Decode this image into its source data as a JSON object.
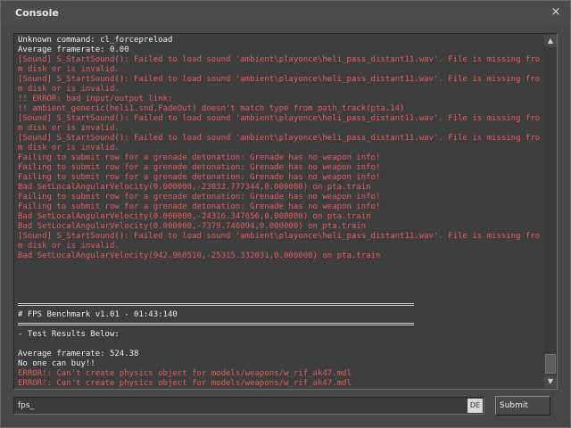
{
  "window": {
    "title": "Console",
    "close_glyph": "×"
  },
  "console": {
    "lines": [
      {
        "type": "normal",
        "text": "Unknown command: cl_forcepreload"
      },
      {
        "type": "normal",
        "text": "Average framerate: 0.00"
      },
      {
        "type": "error",
        "text": "[Sound] S_StartSound(): Failed to load sound 'ambient\\playonce\\heli_pass_distant11.wav'. File is missing from disk or is invalid."
      },
      {
        "type": "error",
        "text": "[Sound] S_StartSound(): Failed to load sound 'ambient\\playonce\\heli_pass_distant11.wav'. File is missing from disk or is invalid."
      },
      {
        "type": "error",
        "text": "!! ERROR: bad input/output link:"
      },
      {
        "type": "error",
        "text": "!! ambient_generic(heli1.snd,FadeOut) doesn't match type from path_track(pta.14)"
      },
      {
        "type": "error",
        "text": "[Sound] S_StartSound(): Failed to load sound 'ambient\\playonce\\heli_pass_distant11.wav'. File is missing from disk or is invalid."
      },
      {
        "type": "error",
        "text": "[Sound] S_StartSound(): Failed to load sound 'ambient\\playonce\\heli_pass_distant11.wav'. File is missing from disk or is invalid."
      },
      {
        "type": "error",
        "text": "Failing to submit row for a grenade detonation: Grenade has no weapon info!"
      },
      {
        "type": "error",
        "text": "Failing to submit row for a grenade detonation: Grenade has no weapon info!"
      },
      {
        "type": "error",
        "text": "Failing to submit row for a grenade detonation: Grenade has no weapon info!"
      },
      {
        "type": "error",
        "text": "Bad SetLocalAngularVelocity(0.000000,-23033.777344,0.000000) on pta.train"
      },
      {
        "type": "error",
        "text": "Failing to submit row for a grenade detonation: Grenade has no weapon info!"
      },
      {
        "type": "error",
        "text": "Failing to submit row for a grenade detonation: Grenade has no weapon info!"
      },
      {
        "type": "error",
        "text": "Bad SetLocalAngularVelocity(0.000000,-24316.347656,0.000000) on pta.train"
      },
      {
        "type": "error",
        "text": "Bad SetLocalAngularVelocity(0.000000,-7379.746094,0.000000) on pta.train"
      },
      {
        "type": "error",
        "text": "[Sound] S_StartSound(): Failed to load sound 'ambient\\playonce\\heli_pass_distant11.wav'. File is missing from disk or is invalid."
      },
      {
        "type": "error",
        "text": "Bad SetLocalAngularVelocity(942.960510,-25315.332031,0.000000) on pta.train"
      },
      {
        "type": "blank",
        "text": ""
      },
      {
        "type": "blank",
        "text": ""
      },
      {
        "type": "blank",
        "text": ""
      },
      {
        "type": "blank",
        "text": ""
      },
      {
        "type": "sep",
        "text": ""
      },
      {
        "type": "normal",
        "text": "# FPS Benchmark v1.01 - 01:43:140"
      },
      {
        "type": "sep",
        "text": ""
      },
      {
        "type": "normal",
        "text": "- Test Results Below:"
      },
      {
        "type": "blank",
        "text": ""
      },
      {
        "type": "normal",
        "text": "Average framerate: 524.38"
      },
      {
        "type": "normal",
        "text": "No one can buy!!"
      },
      {
        "type": "error",
        "text": "ERROR!: Can't create physics object for models/weapons/w_rif_ak47.mdl"
      },
      {
        "type": "error",
        "text": "ERROR!: Can't create physics object for models/weapons/w_rif_ak47.mdl"
      }
    ],
    "colors": {
      "normal": "#ececec",
      "error": "#e85a5a",
      "background": "#3e3e3e"
    }
  },
  "scrollbar": {
    "up_glyph": "▲",
    "down_glyph": "▼"
  },
  "input": {
    "value": "fps_",
    "language_indicator": "DE"
  },
  "submit": {
    "label": "Submit"
  }
}
